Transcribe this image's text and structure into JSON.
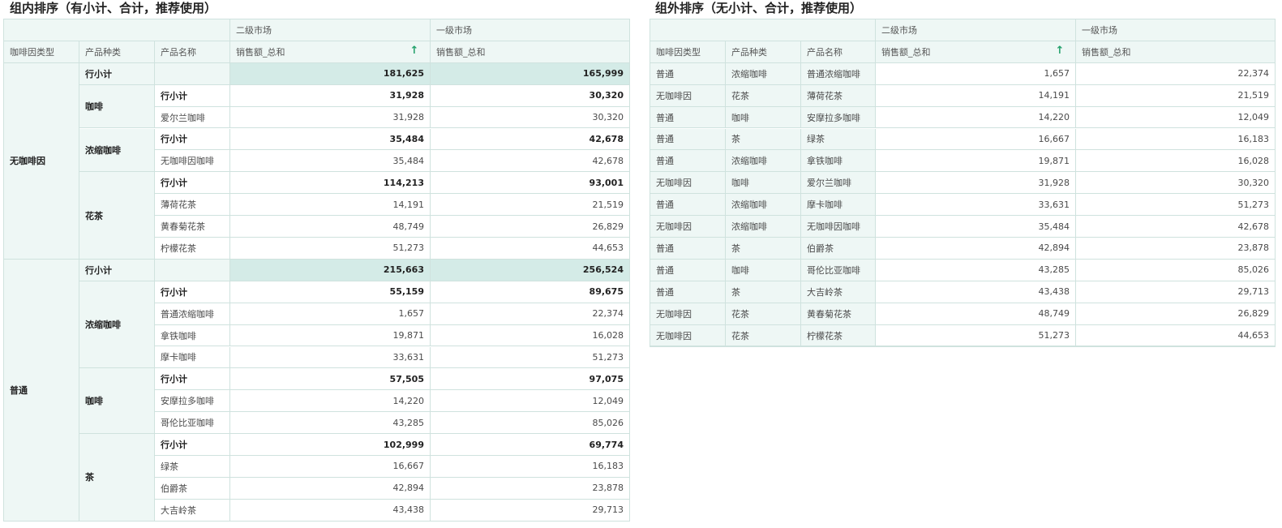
{
  "left": {
    "title": "组内排序（有小计、合计，推荐使用）",
    "headers": {
      "col_market2": "二级市场",
      "col_market1": "一级市场",
      "dim1": "咖啡因类型",
      "dim2": "产品种类",
      "dim3": "产品名称",
      "measure_m2": "销售额_总和",
      "measure_m1": "销售额_总和"
    },
    "sort_icon": "arrow-up-icon",
    "groups": [
      {
        "label": "无咖啡因",
        "subtotal": {
          "label": "行小计",
          "m2": "181,625",
          "m1": "165,999"
        },
        "categories": [
          {
            "label": "咖啡",
            "subtotal": {
              "label": "行小计",
              "m2": "31,928",
              "m1": "30,320"
            },
            "items": [
              {
                "name": "爱尔兰咖啡",
                "m2": "31,928",
                "m1": "30,320"
              }
            ]
          },
          {
            "label": "浓缩咖啡",
            "subtotal": {
              "label": "行小计",
              "m2": "35,484",
              "m1": "42,678"
            },
            "items": [
              {
                "name": "无咖啡因咖啡",
                "m2": "35,484",
                "m1": "42,678"
              }
            ]
          },
          {
            "label": "花茶",
            "subtotal": {
              "label": "行小计",
              "m2": "114,213",
              "m1": "93,001"
            },
            "items": [
              {
                "name": "薄荷花茶",
                "m2": "14,191",
                "m1": "21,519"
              },
              {
                "name": "黄春菊花茶",
                "m2": "48,749",
                "m1": "26,829"
              },
              {
                "name": "柠檬花茶",
                "m2": "51,273",
                "m1": "44,653"
              }
            ]
          }
        ]
      },
      {
        "label": "普通",
        "subtotal": {
          "label": "行小计",
          "m2": "215,663",
          "m1": "256,524"
        },
        "categories": [
          {
            "label": "浓缩咖啡",
            "subtotal": {
              "label": "行小计",
              "m2": "55,159",
              "m1": "89,675"
            },
            "items": [
              {
                "name": "普通浓缩咖啡",
                "m2": "1,657",
                "m1": "22,374"
              },
              {
                "name": "拿铁咖啡",
                "m2": "19,871",
                "m1": "16,028"
              },
              {
                "name": "摩卡咖啡",
                "m2": "33,631",
                "m1": "51,273"
              }
            ]
          },
          {
            "label": "咖啡",
            "subtotal": {
              "label": "行小计",
              "m2": "57,505",
              "m1": "97,075"
            },
            "items": [
              {
                "name": "安摩拉多咖啡",
                "m2": "14,220",
                "m1": "12,049"
              },
              {
                "name": "哥伦比亚咖啡",
                "m2": "43,285",
                "m1": "85,026"
              }
            ]
          },
          {
            "label": "茶",
            "subtotal": {
              "label": "行小计",
              "m2": "102,999",
              "m1": "69,774"
            },
            "items": [
              {
                "name": "绿茶",
                "m2": "16,667",
                "m1": "16,183"
              },
              {
                "name": "伯爵茶",
                "m2": "42,894",
                "m1": "23,878"
              },
              {
                "name": "大吉岭茶",
                "m2": "43,438",
                "m1": "29,713"
              }
            ]
          }
        ]
      }
    ]
  },
  "right": {
    "title": "组外排序（无小计、合计，推荐使用）",
    "headers": {
      "col_market2": "二级市场",
      "col_market1": "一级市场",
      "dim1": "咖啡因类型",
      "dim2": "产品种类",
      "dim3": "产品名称",
      "measure_m2": "销售额_总和",
      "measure_m1": "销售额_总和"
    },
    "sort_icon": "arrow-up-icon",
    "rows": [
      {
        "caffeine": "普通",
        "category": "浓缩咖啡",
        "name": "普通浓缩咖啡",
        "m2": "1,657",
        "m1": "22,374"
      },
      {
        "caffeine": "无咖啡因",
        "category": "花茶",
        "name": "薄荷花茶",
        "m2": "14,191",
        "m1": "21,519"
      },
      {
        "caffeine": "普通",
        "category": "咖啡",
        "name": "安摩拉多咖啡",
        "m2": "14,220",
        "m1": "12,049"
      },
      {
        "caffeine": "普通",
        "category": "茶",
        "name": "绿茶",
        "m2": "16,667",
        "m1": "16,183"
      },
      {
        "caffeine": "普通",
        "category": "浓缩咖啡",
        "name": "拿铁咖啡",
        "m2": "19,871",
        "m1": "16,028"
      },
      {
        "caffeine": "无咖啡因",
        "category": "咖啡",
        "name": "爱尔兰咖啡",
        "m2": "31,928",
        "m1": "30,320"
      },
      {
        "caffeine": "普通",
        "category": "浓缩咖啡",
        "name": "摩卡咖啡",
        "m2": "33,631",
        "m1": "51,273"
      },
      {
        "caffeine": "无咖啡因",
        "category": "浓缩咖啡",
        "name": "无咖啡因咖啡",
        "m2": "35,484",
        "m1": "42,678"
      },
      {
        "caffeine": "普通",
        "category": "茶",
        "name": "伯爵茶",
        "m2": "42,894",
        "m1": "23,878"
      },
      {
        "caffeine": "普通",
        "category": "咖啡",
        "name": "哥伦比亚咖啡",
        "m2": "43,285",
        "m1": "85,026"
      },
      {
        "caffeine": "普通",
        "category": "茶",
        "name": "大吉岭茶",
        "m2": "43,438",
        "m1": "29,713"
      },
      {
        "caffeine": "无咖啡因",
        "category": "花茶",
        "name": "黄春菊花茶",
        "m2": "48,749",
        "m1": "26,829"
      },
      {
        "caffeine": "无咖啡因",
        "category": "花茶",
        "name": "柠檬花茶",
        "m2": "51,273",
        "m1": "44,653"
      }
    ]
  },
  "colors": {
    "header_bg": "#eef7f5",
    "highlight_bg": "#d4ebe7",
    "border": "#cfe2de",
    "sort_icon": "#22a06b"
  }
}
